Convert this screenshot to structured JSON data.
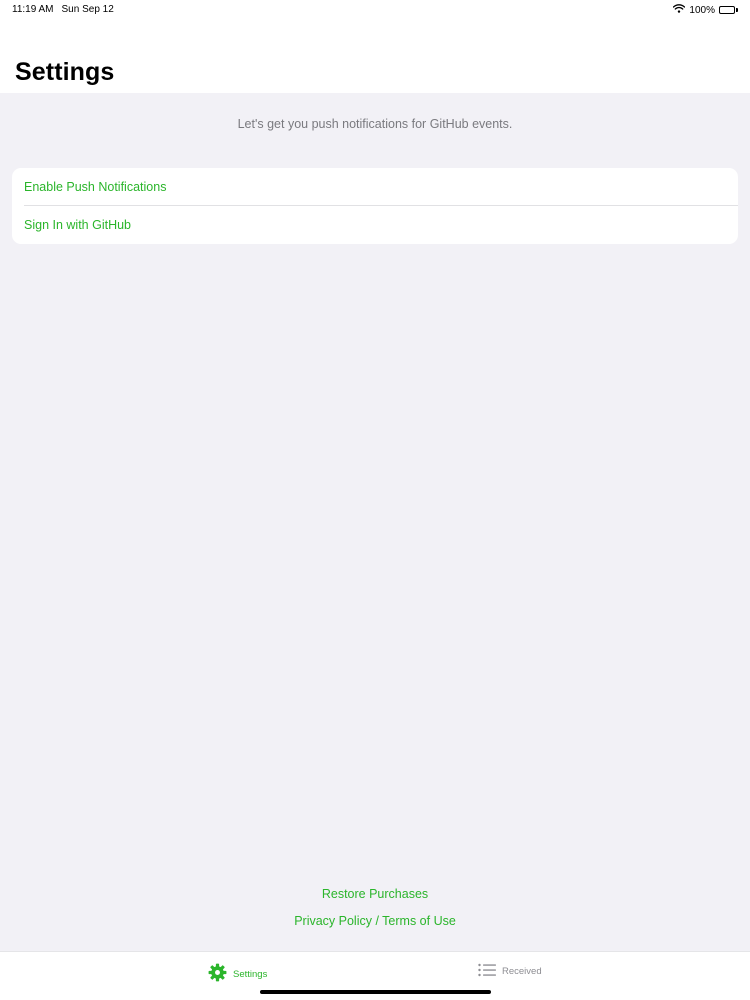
{
  "status_bar": {
    "time": "11:19 AM",
    "date": "Sun Sep 12",
    "battery_percent": "100%",
    "icons": [
      "wifi-icon",
      "battery-icon"
    ]
  },
  "header": {
    "title": "Settings"
  },
  "intro": {
    "text": "Let's get you push notifications for GitHub events."
  },
  "options": {
    "enable_push": "Enable Push Notifications",
    "sign_in": "Sign In with GitHub"
  },
  "footer": {
    "restore": "Restore Purchases",
    "legal": "Privacy Policy / Terms of Use"
  },
  "tab_bar": {
    "settings_label": "Settings",
    "settings_icon": "gear-icon",
    "received_label": "Received",
    "received_icon": "list-icon",
    "active": "Settings"
  },
  "colors": {
    "accent": "#2bb52b",
    "background": "#f2f1f6",
    "secondary_text": "#7a7a7f",
    "inactive_tab": "#8e8e93"
  }
}
